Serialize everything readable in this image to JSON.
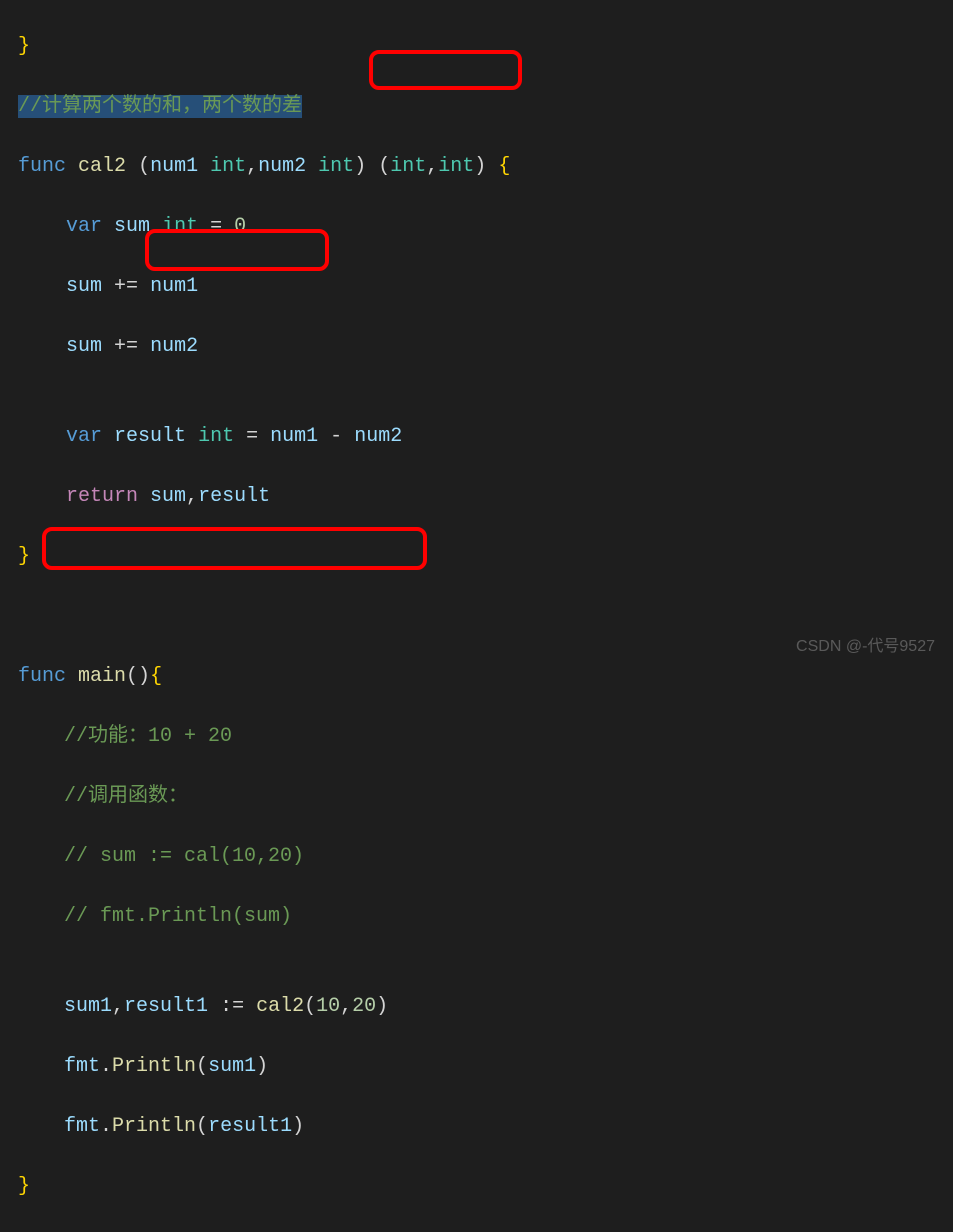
{
  "lines": {
    "l0_brace": "}",
    "l1_comment": "//计算两个数的和，两个数的差",
    "l2": {
      "func": "func",
      "sp1": " ",
      "name": "cal2",
      "sp2": " ",
      "op": "(",
      "p1": "num1",
      "sp3": " ",
      "t1": "int",
      "c1": ",",
      "p2": "num2",
      "sp4": " ",
      "t2": "int",
      "cp": ")",
      "sp5": " ",
      "op2": "(",
      "t3": "int",
      "c2": ",",
      "t4": "int",
      "cp2": ")",
      "sp6": " ",
      "ob": "{"
    },
    "l3": {
      "var": "var",
      "sp": " ",
      "name": "sum",
      "sp2": " ",
      "type": "int",
      "sp3": " ",
      "eq": "=",
      "sp4": " ",
      "val": "0"
    },
    "l4": {
      "name": "sum",
      "sp": " ",
      "op": "+=",
      "sp2": " ",
      "rhs": "num1"
    },
    "l5": {
      "name": "sum",
      "sp": " ",
      "op": "+=",
      "sp2": " ",
      "rhs": "num2"
    },
    "l6_blank": "",
    "l7": {
      "var": "var",
      "sp": " ",
      "name": "result",
      "sp2": " ",
      "type": "int",
      "sp3": " ",
      "eq": "=",
      "sp4": " ",
      "a": "num1",
      "sp5": " ",
      "minus": "-",
      "sp6": " ",
      "b": "num2"
    },
    "l8": {
      "ret": "return",
      "sp": " ",
      "a": "sum",
      "c": ",",
      "b": "result"
    },
    "l9_brace": "}",
    "l10_blank": "",
    "l11_blank": "",
    "l12": {
      "func": "func",
      "sp": " ",
      "name": "main",
      "paren": "()",
      "ob": "{"
    },
    "l13_comment": "//功能：10 + 20",
    "l14_comment": "//调用函数：",
    "l15_comment": "// sum := cal(10,20)",
    "l16_comment": "// fmt.Println(sum)",
    "l17_blank": "",
    "l18": {
      "a": "sum1",
      "c1": ",",
      "b": "result1",
      "sp": " ",
      "op": ":=",
      "sp2": " ",
      "fn": "cal2",
      "op2": "(",
      "n1": "10",
      "c2": ",",
      "n2": "20",
      "cp": ")"
    },
    "l19": {
      "pkg": "fmt",
      "dot": ".",
      "fn": "Println",
      "op": "(",
      "arg": "sum1",
      "cp": ")"
    },
    "l20": {
      "pkg": "fmt",
      "dot": ".",
      "fn": "Println",
      "op": "(",
      "arg": "result1",
      "cp": ")"
    },
    "l21_brace": "}"
  },
  "watermark": "CSDN @-代号9527"
}
